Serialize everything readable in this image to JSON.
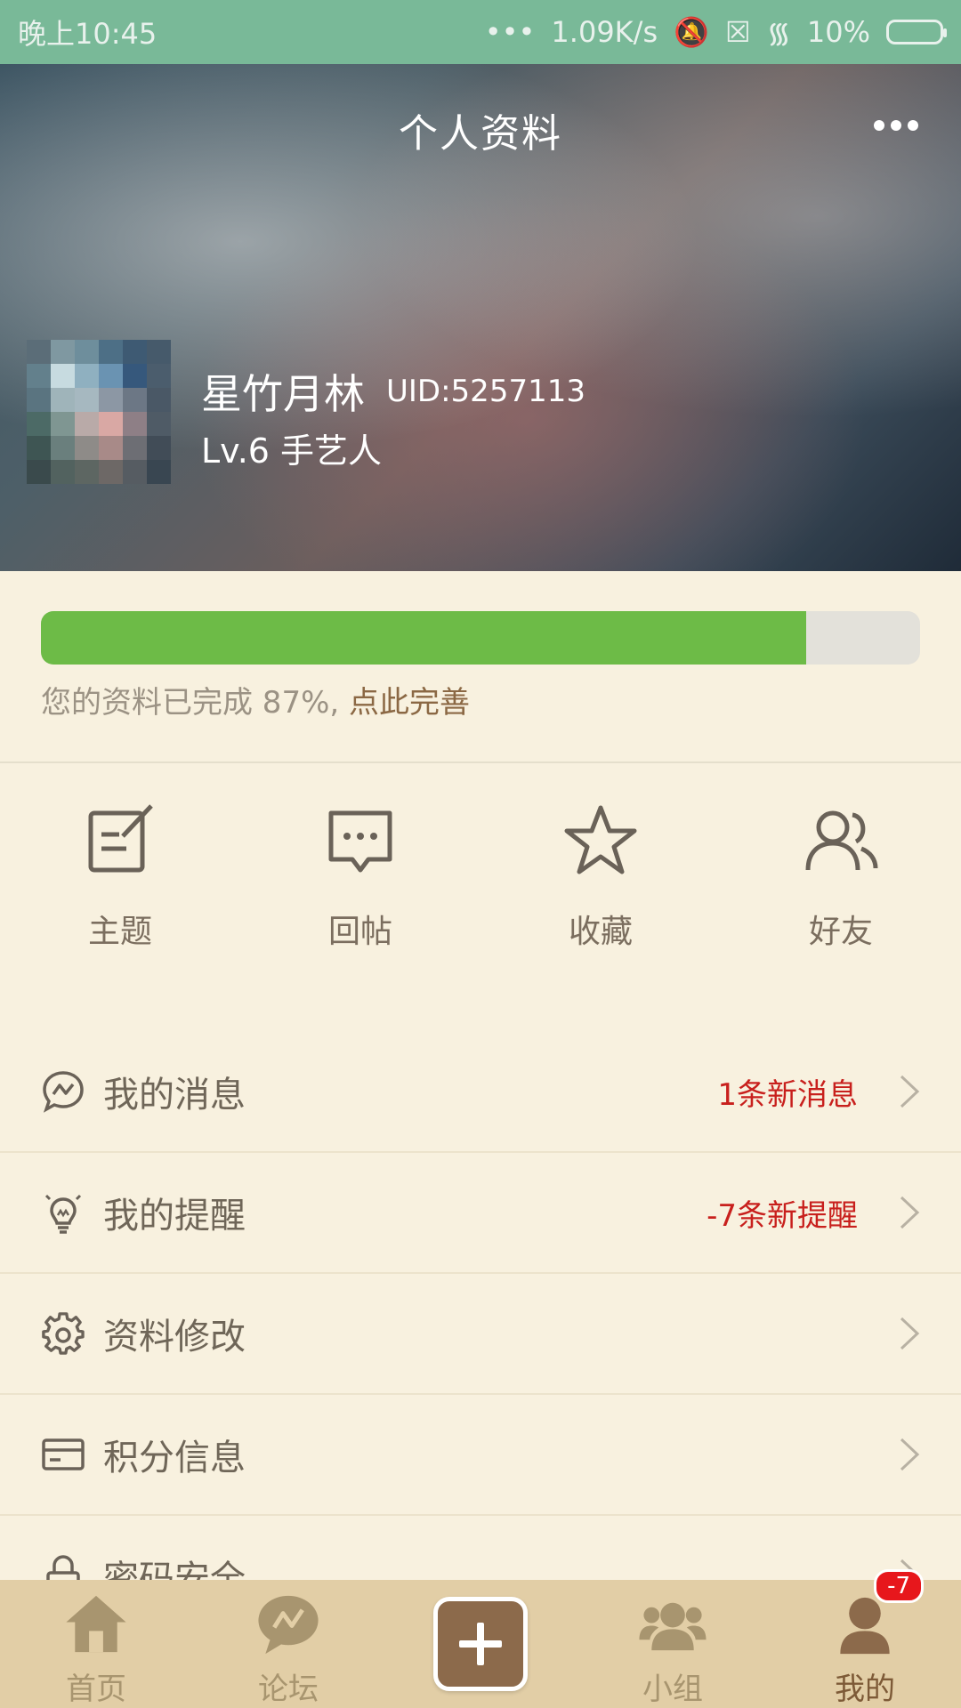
{
  "status_bar": {
    "time": "晚上10:45",
    "network_speed": "1.09K/s",
    "battery": "10%"
  },
  "header": {
    "title": "个人资料",
    "username": "星竹月林",
    "uid": "UID:5257113",
    "level": "Lv.6 手艺人"
  },
  "profile_completion": {
    "percent": 87,
    "text_prefix": "您的资料已完成 87%,",
    "link_text": "点此完善"
  },
  "shortcuts": [
    {
      "label": "主题",
      "icon": "topic-edit-icon"
    },
    {
      "label": "回帖",
      "icon": "reply-chat-icon"
    },
    {
      "label": "收藏",
      "icon": "star-icon"
    },
    {
      "label": "好友",
      "icon": "friends-icon"
    }
  ],
  "menu": [
    {
      "label": "我的消息",
      "badge": "1条新消息",
      "icon": "message-icon"
    },
    {
      "label": "我的提醒",
      "badge": "-7条新提醒",
      "icon": "bulb-icon"
    },
    {
      "label": "资料修改",
      "badge": "",
      "icon": "gear-icon"
    },
    {
      "label": "积分信息",
      "badge": "",
      "icon": "card-icon"
    },
    {
      "label": "密码安全",
      "badge": "",
      "icon": "lock-icon"
    }
  ],
  "bottom_nav": [
    {
      "label": "首页",
      "icon": "home-icon"
    },
    {
      "label": "论坛",
      "icon": "forum-icon"
    },
    {
      "label": "",
      "icon": "plus-icon"
    },
    {
      "label": "小组",
      "icon": "group-icon"
    },
    {
      "label": "我的",
      "icon": "profile-icon",
      "badge": "-7"
    }
  ],
  "colors": {
    "status_bar": "#79b998",
    "background": "#f8f1df",
    "progress_fill": "#6dbb47",
    "alert_red": "#c8201d",
    "nav_bg": "#e2cea6",
    "accent_brown": "#8c6a4b"
  }
}
